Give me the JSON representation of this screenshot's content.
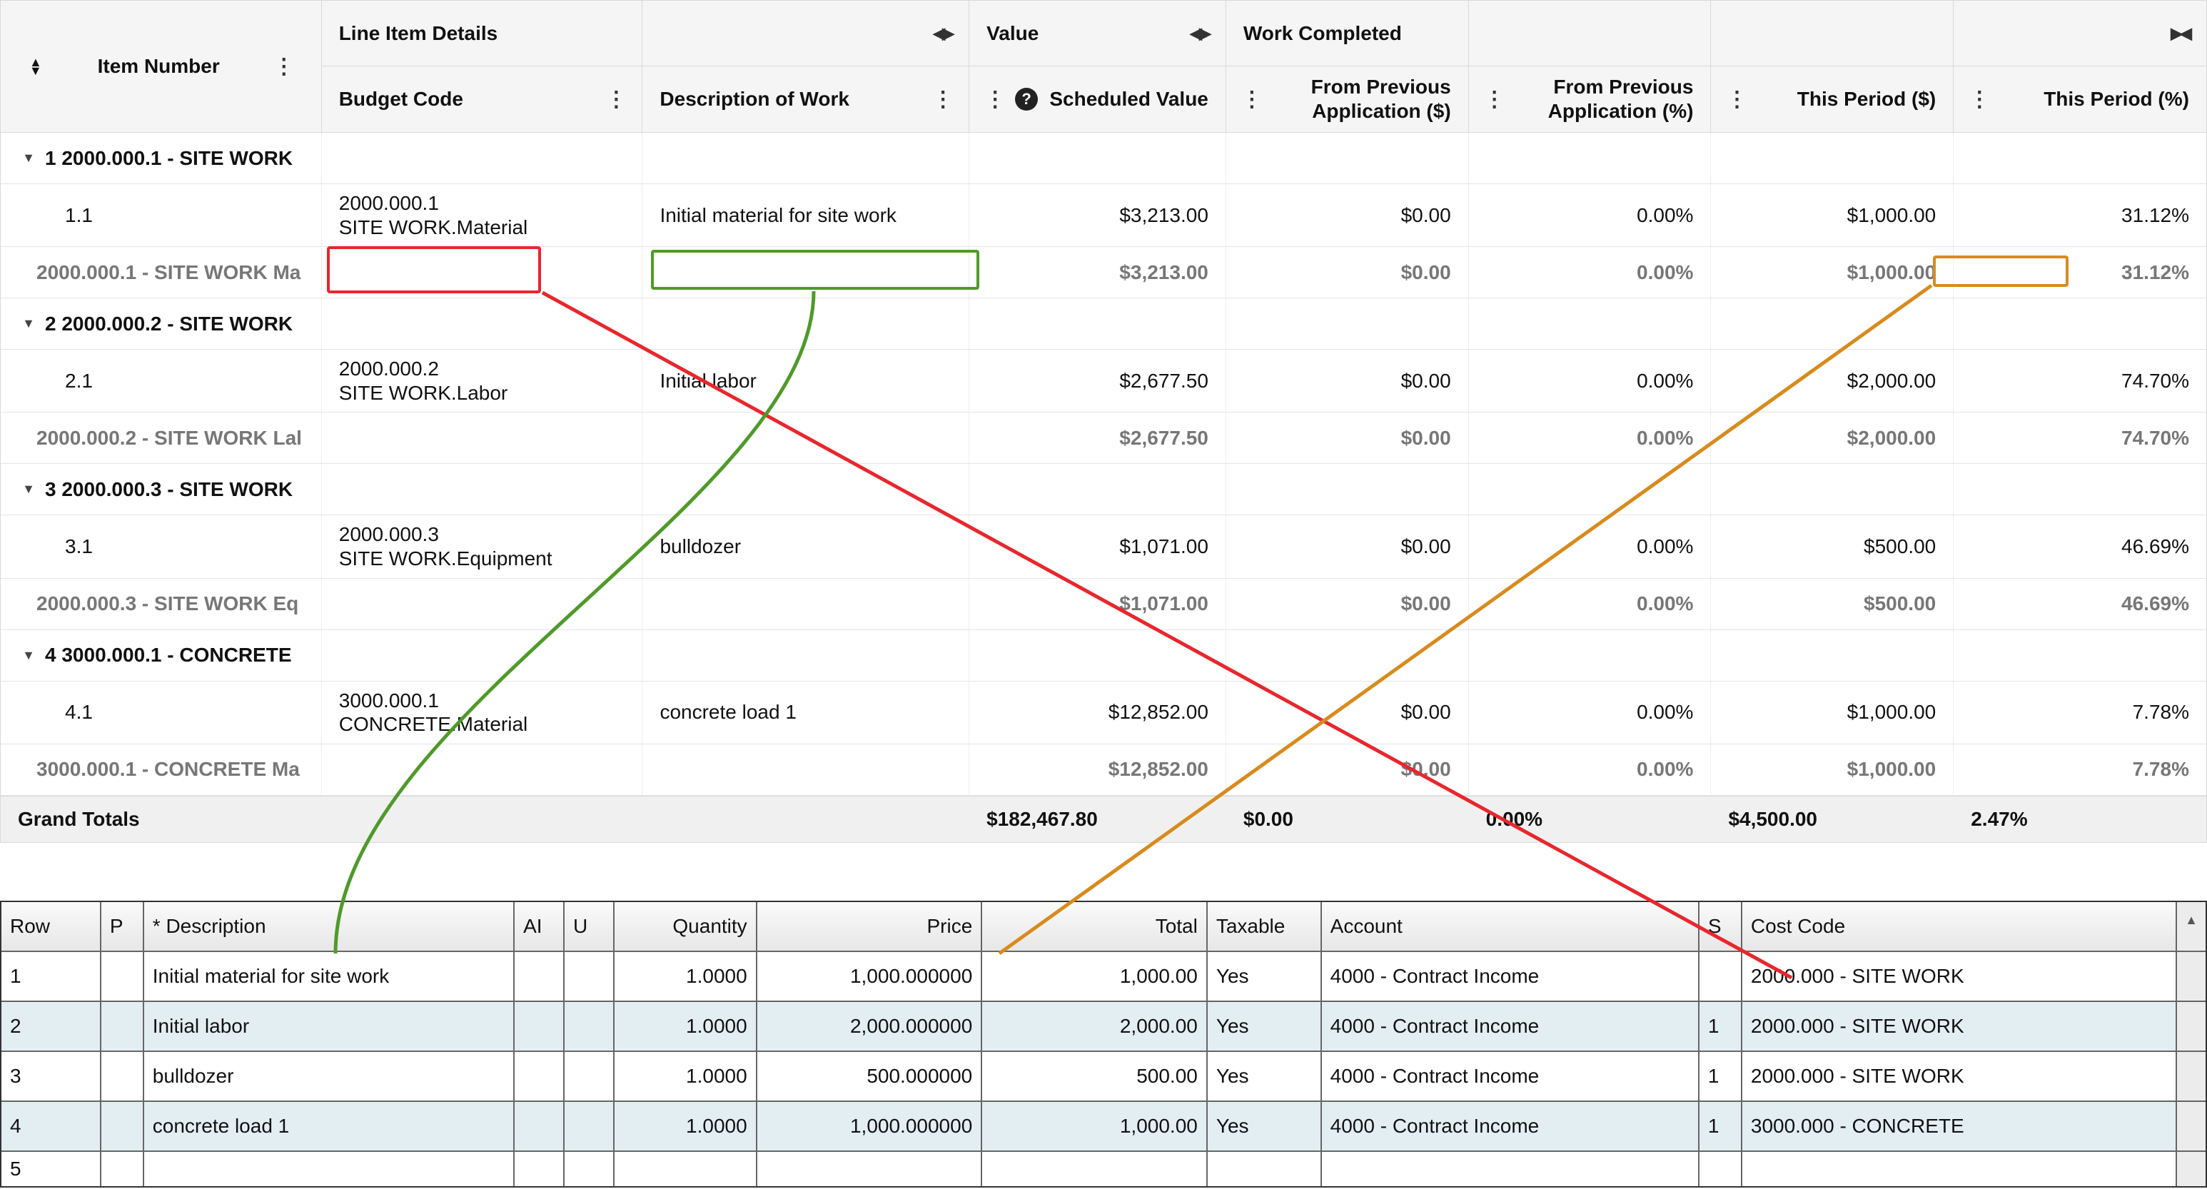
{
  "top": {
    "item_number_header": "Item Number",
    "groups": {
      "line_item_details": "Line Item Details",
      "value": "Value",
      "work_completed": "Work Completed"
    },
    "cols": {
      "budget_code": "Budget Code",
      "description": "Description of Work",
      "scheduled_value": "Scheduled Value",
      "prev_app_amt": "From Previous Application ($)",
      "prev_app_pct": "From Previous Application (%)",
      "this_period_amt": "This Period ($)",
      "this_period_pct": "This Period (%)"
    },
    "sections": [
      {
        "group_label": "1 2000.000.1 - SITE WORK",
        "items": [
          {
            "num": "1.1",
            "code_top": "2000.000.1",
            "code_bottom": "SITE WORK.Material",
            "desc": "Initial material for site work",
            "sched": "$3,213.00",
            "prev_a": "$0.00",
            "prev_p": "0.00%",
            "this_a": "$1,000.00",
            "this_p": "31.12%"
          }
        ],
        "subtotal": {
          "label": "2000.000.1 - SITE WORK Ma",
          "sched": "$3,213.00",
          "prev_a": "$0.00",
          "prev_p": "0.00%",
          "this_a": "$1,000.00",
          "this_p": "31.12%"
        }
      },
      {
        "group_label": "2 2000.000.2 - SITE WORK",
        "items": [
          {
            "num": "2.1",
            "code_top": "2000.000.2",
            "code_bottom": "SITE WORK.Labor",
            "desc": "Initial labor",
            "sched": "$2,677.50",
            "prev_a": "$0.00",
            "prev_p": "0.00%",
            "this_a": "$2,000.00",
            "this_p": "74.70%"
          }
        ],
        "subtotal": {
          "label": "2000.000.2 - SITE WORK Lal",
          "sched": "$2,677.50",
          "prev_a": "$0.00",
          "prev_p": "0.00%",
          "this_a": "$2,000.00",
          "this_p": "74.70%"
        }
      },
      {
        "group_label": "3 2000.000.3 - SITE WORK",
        "items": [
          {
            "num": "3.1",
            "code_top": "2000.000.3",
            "code_bottom": "SITE WORK.Equipment",
            "desc": "bulldozer",
            "sched": "$1,071.00",
            "prev_a": "$0.00",
            "prev_p": "0.00%",
            "this_a": "$500.00",
            "this_p": "46.69%"
          }
        ],
        "subtotal": {
          "label": "2000.000.3 - SITE WORK Eq",
          "sched": "$1,071.00",
          "prev_a": "$0.00",
          "prev_p": "0.00%",
          "this_a": "$500.00",
          "this_p": "46.69%"
        }
      },
      {
        "group_label": "4 3000.000.1 - CONCRETE",
        "items": [
          {
            "num": "4.1",
            "code_top": "3000.000.1",
            "code_bottom": "CONCRETE.Material",
            "desc": "concrete load 1",
            "sched": "$12,852.00",
            "prev_a": "$0.00",
            "prev_p": "0.00%",
            "this_a": "$1,000.00",
            "this_p": "7.78%"
          }
        ],
        "subtotal": {
          "label": "3000.000.1 - CONCRETE Ma",
          "sched": "$12,852.00",
          "prev_a": "$0.00",
          "prev_p": "0.00%",
          "this_a": "$1,000.00",
          "this_p": "7.78%"
        }
      }
    ],
    "grand": {
      "label": "Grand Totals",
      "sched": "$182,467.80",
      "prev_a": "$0.00",
      "prev_p": "0.00%",
      "this_a": "$4,500.00",
      "this_p": "2.47%"
    }
  },
  "bottom": {
    "cols": {
      "row": "Row",
      "p": "P",
      "desc": "* Description",
      "ai": "AI",
      "u": "U",
      "qty": "Quantity",
      "price": "Price",
      "total": "Total",
      "tax": "Taxable",
      "account": "Account",
      "s": "S",
      "cost": "Cost Code"
    },
    "rows": [
      {
        "row": "1",
        "p": "",
        "desc": "Initial material for site work",
        "ai": "",
        "u": "",
        "qty": "1.0000",
        "price": "1,000.000000",
        "total": "1,000.00",
        "tax": "Yes",
        "account": "4000 - Contract Income",
        "s": "",
        "cost": "2000.000 - SITE WORK"
      },
      {
        "row": "2",
        "p": "",
        "desc": "Initial labor",
        "ai": "",
        "u": "",
        "qty": "1.0000",
        "price": "2,000.000000",
        "total": "2,000.00",
        "tax": "Yes",
        "account": "4000 - Contract Income",
        "s": "1",
        "cost": "2000.000 - SITE WORK"
      },
      {
        "row": "3",
        "p": "",
        "desc": "bulldozer",
        "ai": "",
        "u": "",
        "qty": "1.0000",
        "price": "500.000000",
        "total": "500.00",
        "tax": "Yes",
        "account": "4000 - Contract Income",
        "s": "1",
        "cost": "2000.000 - SITE WORK"
      },
      {
        "row": "4",
        "p": "",
        "desc": "concrete load 1",
        "ai": "",
        "u": "",
        "qty": "1.0000",
        "price": "1,000.000000",
        "total": "1,000.00",
        "tax": "Yes",
        "account": "4000 - Contract Income",
        "s": "1",
        "cost": "3000.000 - CONCRETE"
      }
    ],
    "empty_row_label": "5"
  }
}
